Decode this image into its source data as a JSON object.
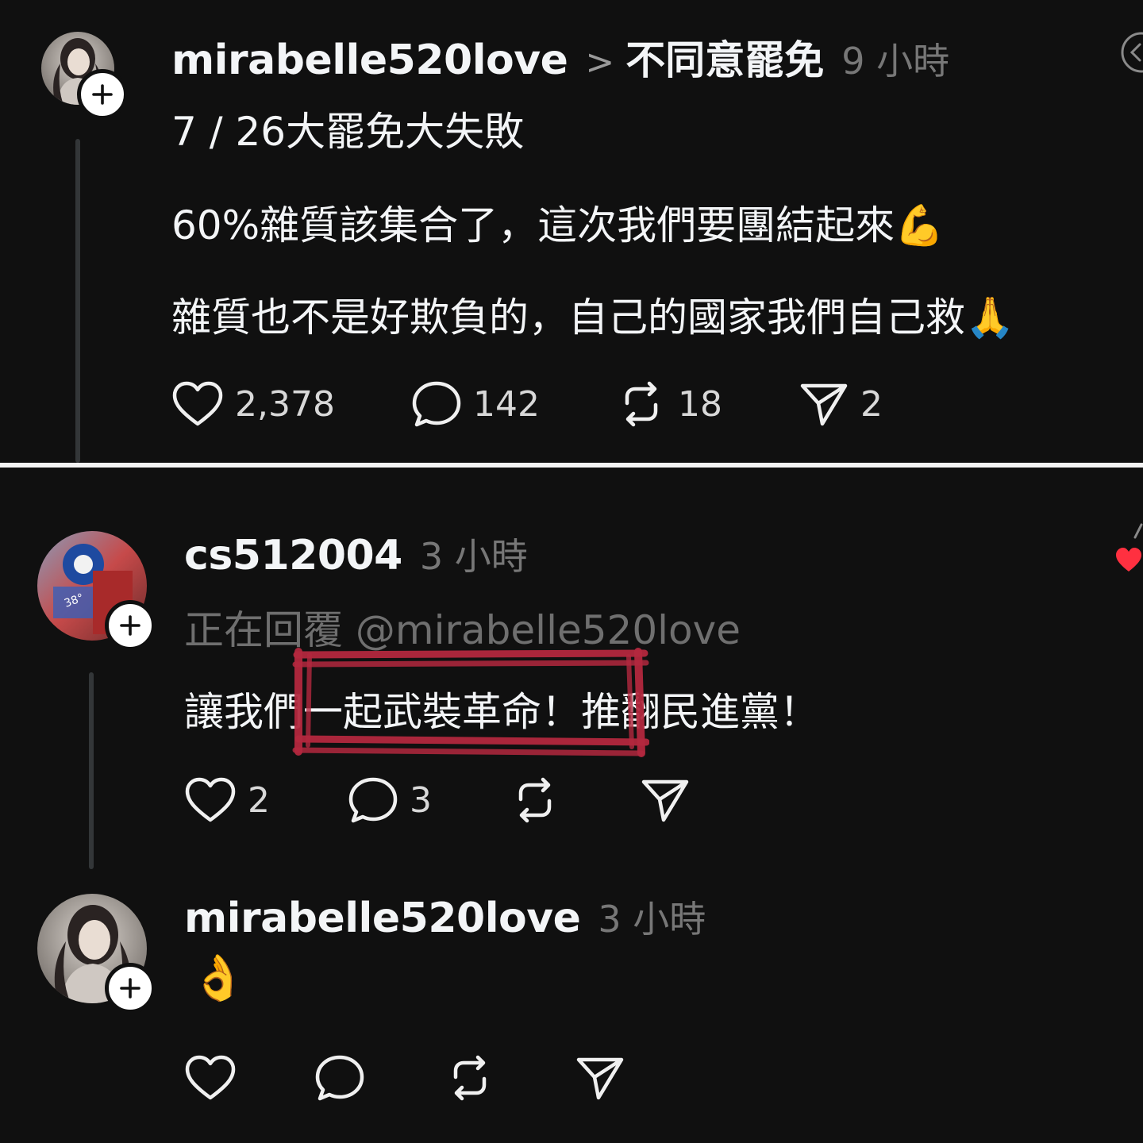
{
  "post": {
    "author": "mirabelle520love",
    "topic_separator": ">",
    "topic": "不同意罷免",
    "time": "9 小時",
    "lines": [
      "7 / 26大罷免大失敗",
      "60%雜質該集合了，這次我們要團結起來💪",
      "雜質也不是好欺負的，自己的國家我們自己救🙏"
    ],
    "actions": {
      "likes": "2,378",
      "comments": "142",
      "reposts": "18",
      "shares": "2"
    }
  },
  "reply": {
    "author": "cs512004",
    "time": "3 小時",
    "replying_to": "正在回覆 @mirabelle520love",
    "text": "讓我們一起武裝革命！推翻民進黨！",
    "actions": {
      "likes": "2",
      "comments": "3"
    },
    "liked_heart_color": "#ff3040"
  },
  "reply2": {
    "author": "mirabelle520love",
    "time": "3 小時",
    "text": "👌"
  },
  "icons": {
    "follow": "plus-icon",
    "like": "heart-icon",
    "comment": "comment-bubble-icon",
    "repost": "repost-icon",
    "share": "send-icon"
  },
  "annotation": {
    "highlight_color": "#b3283e"
  }
}
